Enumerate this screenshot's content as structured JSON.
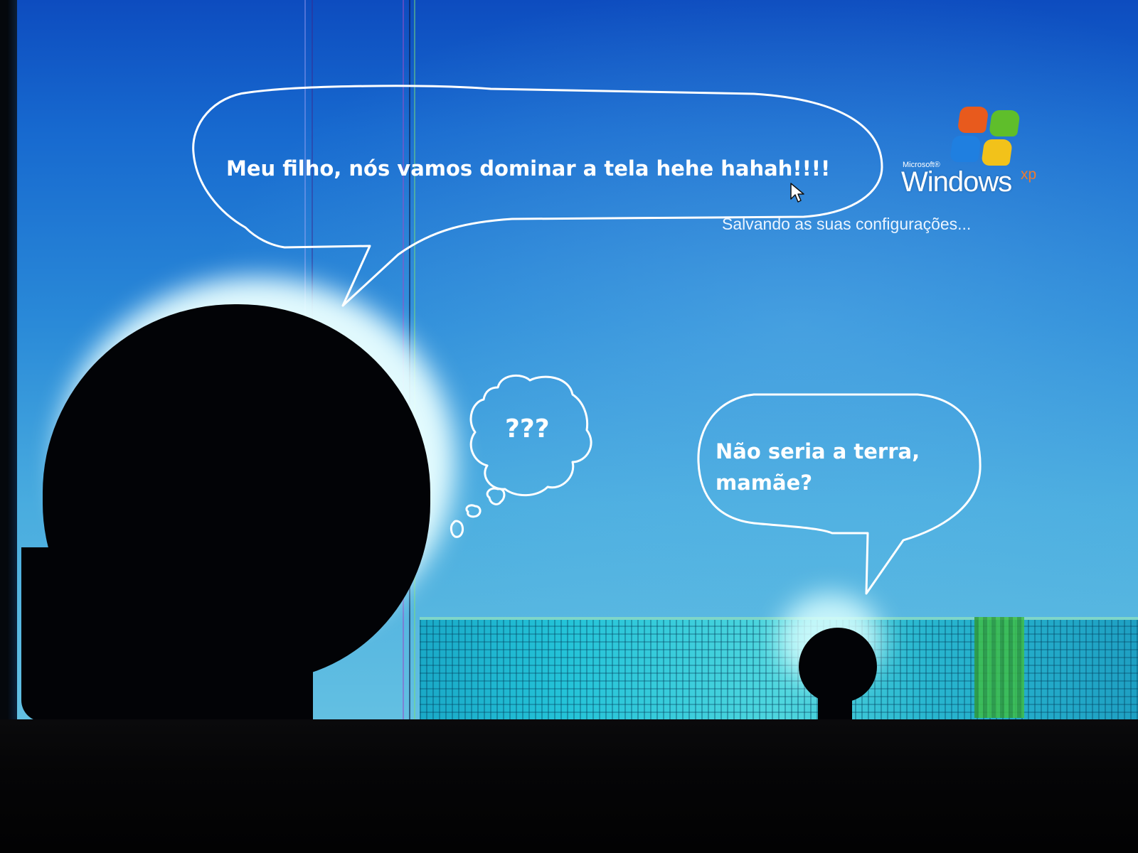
{
  "speech_bubble_1": {
    "text": "Meu filho, nós vamos dominar a tela hehe hahah!!!!"
  },
  "thought_bubble": {
    "text": "???"
  },
  "speech_bubble_2": {
    "line1": "Não seria a terra,",
    "line2": "mamãe?"
  },
  "windows_logo": {
    "microsoft": "Microsoft®",
    "windows": "Windows",
    "suffix": "xp",
    "flag_colors": [
      "#e85a1d",
      "#5fbe2b",
      "#1f7fe0",
      "#f2c21a"
    ]
  },
  "status_text": "Salvando as suas configurações...",
  "icons": {
    "cursor": "mouse-pointer-icon",
    "logo_flag": "windows-flag-icon"
  },
  "colors": {
    "background_top": "#0d4cbf",
    "background_bottom": "#63c0e2",
    "annotation": "#ffffff"
  }
}
